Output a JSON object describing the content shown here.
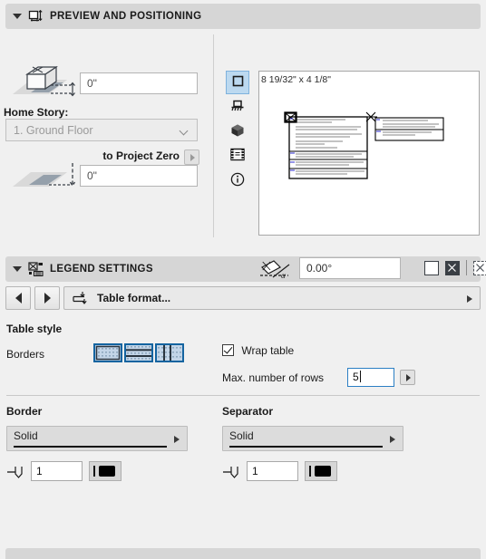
{
  "panels": {
    "preview": {
      "title": "PREVIEW AND POSITIONING",
      "icon": "preview-positioning-icon",
      "collapse_icon": "triangle-down-icon"
    },
    "legend": {
      "title": "LEGEND SETTINGS",
      "icon": "legend-settings-icon",
      "collapse_icon": "triangle-down-icon"
    }
  },
  "positioning": {
    "top_offset_value": "0\"",
    "home_story_label": "Home Story:",
    "home_story_value": "1. Ground Floor",
    "to_project_zero_label": "to Project Zero",
    "bottom_offset_value": "0\"",
    "story_icon": "cube-on-slab-icon",
    "elevation_icon": "slab-elevation-icon",
    "dropdown_icon": "chevron-down-icon",
    "project_zero_arrow_icon": "right-arrow-icon"
  },
  "preview_area": {
    "dimension_text": "8 19/32\" x 4 1/8\"",
    "rail": [
      {
        "name": "2d-symbol-view",
        "icon": "square-outline-icon",
        "selected": true
      },
      {
        "name": "front-view",
        "icon": "elevation-view-icon",
        "selected": false
      },
      {
        "name": "3d-view",
        "icon": "cube-icon",
        "selected": false
      },
      {
        "name": "preview-picture",
        "icon": "filmstrip-icon",
        "selected": false
      },
      {
        "name": "info-view",
        "icon": "info-circle-icon",
        "selected": false
      }
    ],
    "angle_value": "0.00°",
    "angle_icon": "rotation-angle-icon",
    "anchors": [
      {
        "name": "anchor-empty",
        "state": "empty"
      },
      {
        "name": "anchor-filled",
        "state": "filled"
      },
      {
        "name": "anchor-dashed",
        "state": "dashed"
      }
    ]
  },
  "legend_settings": {
    "prev_button_icon": "left-arrow-icon",
    "next_button_icon": "right-arrow-icon",
    "format_label": "Table format...",
    "format_icon": "table-format-icon",
    "format_expand_icon": "right-arrow-icon",
    "table_style_title": "Table style",
    "borders_label": "Borders",
    "border_buttons": [
      {
        "name": "border-outline-button",
        "icon": "outline-border-icon",
        "selected": true
      },
      {
        "name": "border-horizontal-button",
        "icon": "horizontal-lines-icon",
        "selected": true
      },
      {
        "name": "border-vertical-button",
        "icon": "vertical-lines-icon",
        "selected": true
      }
    ],
    "wrap_table_label": "Wrap table",
    "wrap_table_checked": true,
    "max_rows_label": "Max. number of rows",
    "max_rows_value": "5",
    "max_rows_stepper_icon": "right-arrow-icon",
    "border": {
      "title": "Border",
      "line_type": "Solid",
      "line_weight": "1",
      "pen_icon": "pen-weight-icon",
      "color": "#000000",
      "dropdown_icon": "right-arrow-icon",
      "swatch_icon": "pen-color-icon"
    },
    "separator": {
      "title": "Separator",
      "line_type": "Solid",
      "line_weight": "1",
      "pen_icon": "pen-weight-icon",
      "color": "#000000",
      "dropdown_icon": "right-arrow-icon",
      "swatch_icon": "pen-color-icon"
    }
  }
}
